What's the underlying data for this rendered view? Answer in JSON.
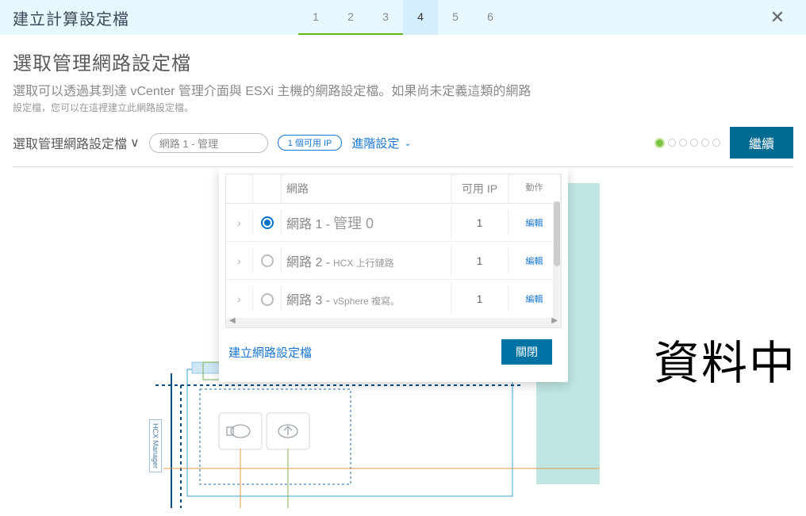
{
  "header": {
    "title": "建立計算設定檔",
    "steps": [
      "1",
      "2",
      "3",
      "4",
      "5",
      "6"
    ],
    "done_steps": [
      0,
      1,
      2
    ],
    "active_step": 3
  },
  "section": {
    "title": "選取管理網路設定檔",
    "desc1": "選取可以透過其到達 vCenter 管理介面與 ESXi 主機的網路設定檔。如果尚未定義這類的網路",
    "desc2": "設定檔，您可以在這裡建立此網路設定檔。"
  },
  "selector": {
    "label": "選取管理網路設定檔",
    "dropdown_suffix": "∨",
    "pill_text": "網路 1 -  管理",
    "ip_pill": "1 個可用 IP",
    "advanced": "進階設定",
    "continue": "繼續",
    "dots": 6,
    "active_dot": 0
  },
  "popover": {
    "columns": {
      "network": "網路",
      "ip": "可用 IP",
      "action": "動作"
    },
    "rows": [
      {
        "net_name": "網路 1 -",
        "net_sub": "管理 0",
        "ip": "1",
        "action": "編輯",
        "selected": true
      },
      {
        "net_name": "網路 2 -",
        "net_sub": "HCX 上行鏈路",
        "ip": "1",
        "action": "編輯",
        "selected": false
      },
      {
        "net_name": "網路 3 -",
        "net_sub": "vSphere 複寫。",
        "ip": "1",
        "action": "編輯",
        "selected": false
      }
    ],
    "create_link": "建立網路設定檔",
    "close": "關閉"
  },
  "canvas": {
    "big_label": "資料中",
    "hcx_manager_label": "HCX Manager"
  }
}
